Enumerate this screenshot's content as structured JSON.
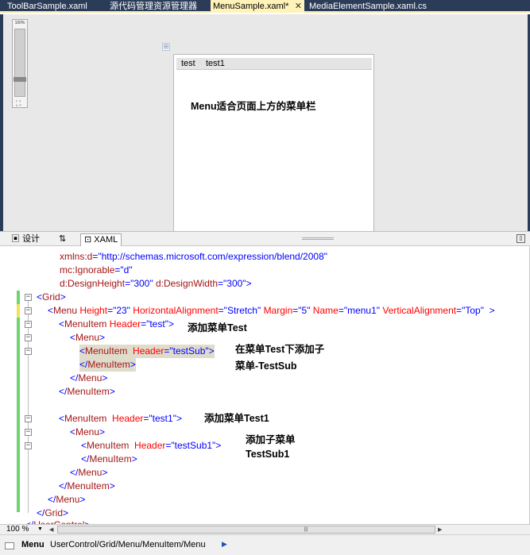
{
  "tabs": [
    {
      "label": "ToolBarSample.xaml",
      "active": false
    },
    {
      "label": "源代码管理资源管理器",
      "active": false
    },
    {
      "label": "MenuSample.xaml*",
      "active": true
    },
    {
      "label": "MediaElementSample.xaml.cs",
      "active": false
    }
  ],
  "tab_close_glyph": "✕",
  "designer": {
    "zoom_label": "100%",
    "zoom_level": 100,
    "menu_items": [
      "test",
      "test1"
    ],
    "annotation": "Menu适合页面上方的菜单栏"
  },
  "view_tabs": {
    "design": "设计",
    "swap": "⇅",
    "xaml": "XAML"
  },
  "code_lines": [
    [
      [
        "r",
        "xmlns:d"
      ],
      [
        "b",
        "=\"http://schemas.microsoft.com/expression/blend/2008\""
      ]
    ],
    [
      [
        "r",
        "mc:Ignorable"
      ],
      [
        "b",
        "=\"d\""
      ]
    ],
    [
      [
        "r",
        "d:DesignHeight"
      ],
      [
        "b",
        "=\"300\" "
      ],
      [
        "r",
        "d:DesignWidth"
      ],
      [
        "b",
        "=\"300\">"
      ]
    ],
    [
      [
        "b",
        "<"
      ],
      [
        "r",
        "Grid"
      ],
      [
        "b",
        ">"
      ]
    ],
    [
      [
        "b",
        "<"
      ],
      [
        "r",
        "Menu "
      ],
      [
        "rd",
        "Height"
      ],
      [
        "b",
        "=\"23\" "
      ],
      [
        "rd",
        "HorizontalAlignment"
      ],
      [
        "b",
        "=\"Stretch\" "
      ],
      [
        "rd",
        "Margin"
      ],
      [
        "b",
        "=\"5\" "
      ],
      [
        "rd",
        "Name"
      ],
      [
        "b",
        "=\"menu1\" "
      ],
      [
        "rd",
        "VerticalAlignment"
      ],
      [
        "b",
        "=\"Top\"  >"
      ]
    ],
    [
      [
        "b",
        "<"
      ],
      [
        "r",
        "MenuItem "
      ],
      [
        "rd",
        "Header"
      ],
      [
        "b",
        "=\"test\">"
      ]
    ],
    [
      [
        "b",
        "<"
      ],
      [
        "r",
        "Menu"
      ],
      [
        "b",
        ">"
      ]
    ],
    [
      [
        "b",
        "<"
      ],
      [
        "r",
        "MenuItem  "
      ],
      [
        "rd",
        "Header"
      ],
      [
        "b",
        "=\"testSub\">"
      ]
    ],
    [
      [
        "b",
        "</"
      ],
      [
        "r",
        "MenuItem"
      ],
      [
        "b",
        ">"
      ]
    ],
    [
      [
        "b",
        "</"
      ],
      [
        "r",
        "Menu"
      ],
      [
        "b",
        ">"
      ]
    ],
    [
      [
        "b",
        "</"
      ],
      [
        "r",
        "MenuItem"
      ],
      [
        "b",
        ">"
      ]
    ],
    [],
    [
      [
        "b",
        "<"
      ],
      [
        "r",
        "MenuItem  "
      ],
      [
        "rd",
        "Header"
      ],
      [
        "b",
        "=\"test1\">"
      ]
    ],
    [
      [
        "b",
        "<"
      ],
      [
        "r",
        "Menu"
      ],
      [
        "b",
        ">"
      ]
    ],
    [
      [
        "b",
        "<"
      ],
      [
        "r",
        "MenuItem  "
      ],
      [
        "rd",
        "Header"
      ],
      [
        "b",
        "=\"testSub1\">"
      ]
    ],
    [
      [
        "b",
        "</"
      ],
      [
        "r",
        "MenuItem"
      ],
      [
        "b",
        ">"
      ]
    ],
    [
      [
        "b",
        "</"
      ],
      [
        "r",
        "Menu"
      ],
      [
        "b",
        ">"
      ]
    ],
    [
      [
        "b",
        "</"
      ],
      [
        "r",
        "MenuItem"
      ],
      [
        "b",
        ">"
      ]
    ],
    [
      [
        "b",
        "</"
      ],
      [
        "r",
        "Menu"
      ],
      [
        "b",
        ">"
      ]
    ],
    [
      [
        "b",
        "</"
      ],
      [
        "r",
        "Grid"
      ],
      [
        "b",
        ">"
      ]
    ],
    [
      [
        "b",
        "</"
      ],
      [
        "r",
        "UserControl"
      ],
      [
        "b",
        ">"
      ]
    ]
  ],
  "annotations": {
    "add_menu_test": "添加菜单Test",
    "add_sub_line1": "在菜单Test下添加子",
    "add_sub_line2": "菜单-TestSub",
    "add_menu_test1": "添加菜单Test1",
    "add_sub1_line1": "添加子菜单",
    "add_sub1_line2": "TestSub1"
  },
  "bottom": {
    "zoom": "100 %",
    "dropdown_glyph": "▼"
  },
  "breadcrumb": {
    "title": "Menu",
    "path": "UserControl/Grid/Menu/MenuItem/Menu",
    "arrow": "▶"
  },
  "colors": {
    "tab_background": "#2b3c59",
    "active_tab": "#fff3b9",
    "tag": "#a31515",
    "attr_value": "#0000ff",
    "attr_name": "#ff0000",
    "change_bar": "#6fd46f"
  }
}
